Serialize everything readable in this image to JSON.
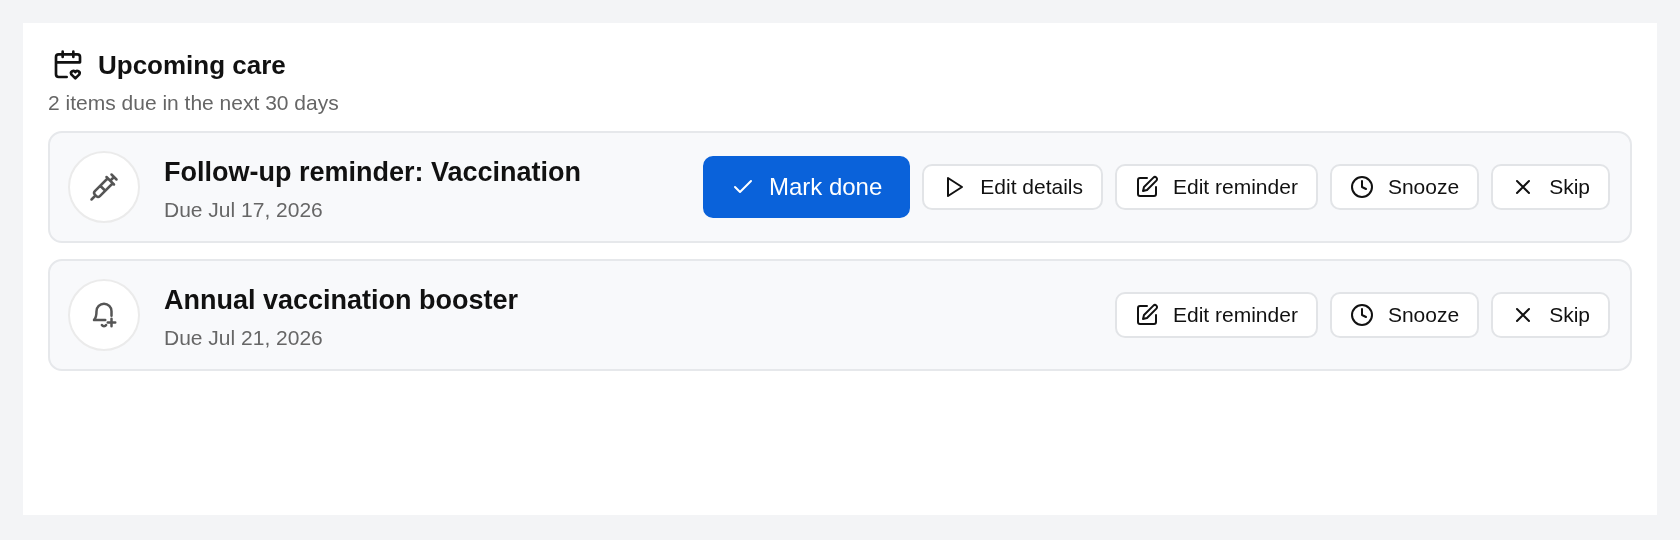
{
  "header": {
    "title": "Upcoming care",
    "subtitle": "2 items due in the next 30 days"
  },
  "items": [
    {
      "kind": "vaccine",
      "title": "Follow-up reminder: Vaccination",
      "due": "Due Jul 17, 2026",
      "actions": [
        {
          "kind": "done",
          "label": "Mark done"
        },
        {
          "kind": "details",
          "label": "Edit details"
        },
        {
          "kind": "edit",
          "label": "Edit reminder"
        },
        {
          "kind": "snooze",
          "label": "Snooze"
        },
        {
          "kind": "skip",
          "label": "Skip"
        }
      ]
    },
    {
      "kind": "reminder",
      "title": "Annual vaccination booster",
      "due": "Due Jul 21, 2026",
      "actions": [
        {
          "kind": "edit",
          "label": "Edit reminder"
        },
        {
          "kind": "snooze",
          "label": "Snooze"
        },
        {
          "kind": "skip",
          "label": "Skip"
        }
      ]
    }
  ]
}
